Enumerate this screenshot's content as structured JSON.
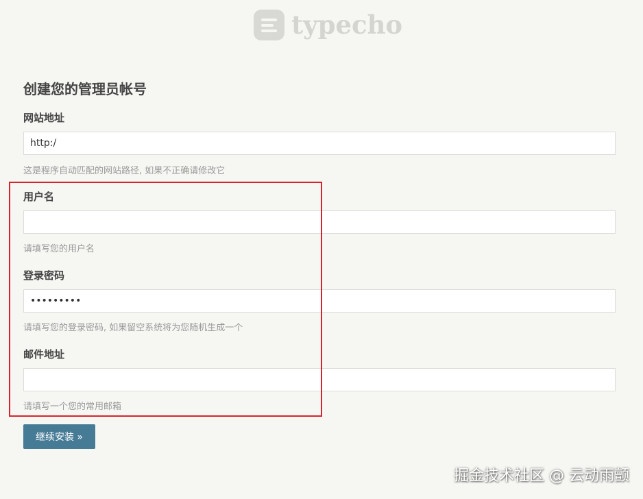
{
  "logo": {
    "text": "typecho"
  },
  "form": {
    "title": "创建您的管理员帐号",
    "site_url": {
      "label": "网站地址",
      "value": "http:/",
      "hint": "这是程序自动匹配的网站路径, 如果不正确请修改它"
    },
    "username": {
      "label": "用户名",
      "value": "",
      "hint": "请填写您的用户名"
    },
    "password": {
      "label": "登录密码",
      "value": "123456789",
      "hint": "请填写您的登录密码, 如果留空系统将为您随机生成一个"
    },
    "email": {
      "label": "邮件地址",
      "value": "",
      "hint": "请填写一个您的常用邮箱"
    },
    "submit_label": "继续安装 »"
  },
  "highlight_color": "#d8232f",
  "accent_color": "#467b96",
  "watermark": {
    "text": "掘金技术社区 @ 云动雨颤"
  }
}
